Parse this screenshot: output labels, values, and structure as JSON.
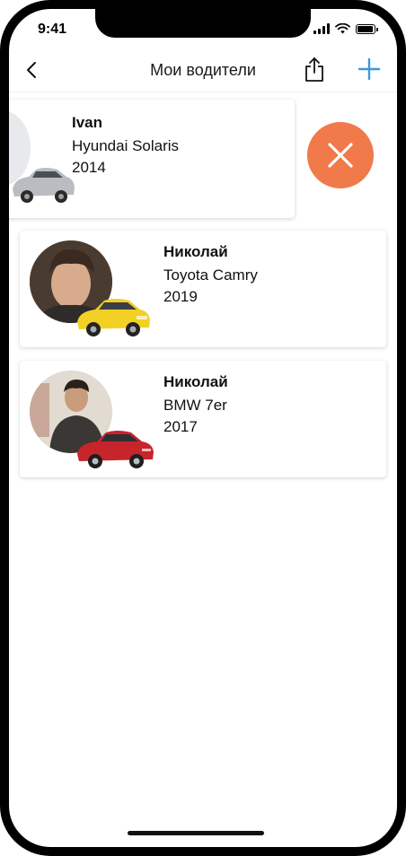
{
  "status_bar": {
    "time": "9:41"
  },
  "nav": {
    "title": "Мои водители",
    "back_icon": "chevron-left-icon",
    "share_icon": "share-icon",
    "add_icon": "plus-icon",
    "accent_color": "#3a97e0"
  },
  "drivers": [
    {
      "name": "Ivan",
      "car": "Hyundai Solaris",
      "year": "2014",
      "car_color": "#b9bcc0",
      "swiped": true
    },
    {
      "name": "Николай",
      "car": "Toyota Camry",
      "year": "2019",
      "car_color": "#f2d024",
      "swiped": false
    },
    {
      "name": "Николай",
      "car": "BMW 7er",
      "year": "2017",
      "car_color": "#c8242b",
      "swiped": false
    }
  ],
  "delete_action": {
    "icon": "close-icon",
    "color": "#f07a4a"
  }
}
